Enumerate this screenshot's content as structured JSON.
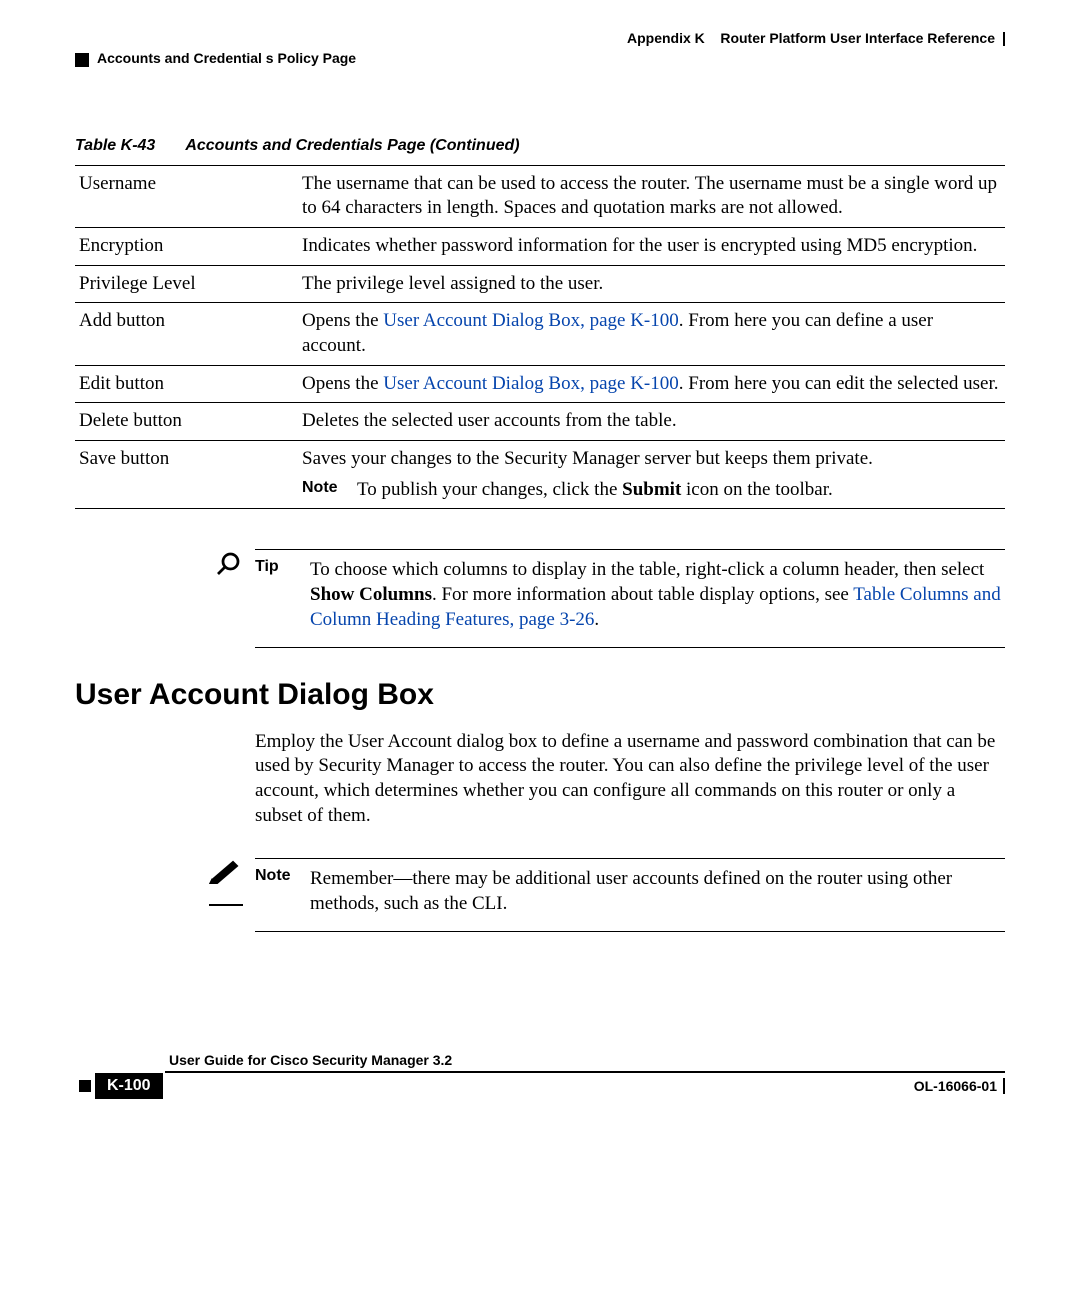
{
  "header": {
    "appendix": "Appendix K",
    "appendix_title": "Router Platform User Interface Reference",
    "section": "Accounts and Credential s Policy Page"
  },
  "table": {
    "number": "Table K-43",
    "title": "Accounts and Credentials Page (Continued)",
    "rows": [
      {
        "name": "Username",
        "desc": "The username that can be used to access the router. The username must be a single word up to 64 characters in length. Spaces and quotation marks are not allowed."
      },
      {
        "name": "Encryption",
        "desc": "Indicates whether password information for the user is encrypted using MD5 encryption."
      },
      {
        "name": "Privilege Level",
        "desc": "The privilege level assigned to the user."
      },
      {
        "name": "Add button",
        "desc_pre": "Opens the ",
        "link": "User Account Dialog Box, page K-100",
        "desc_post": ". From here you can define a user account."
      },
      {
        "name": "Edit button",
        "desc_pre": "Opens the ",
        "link": "User Account Dialog Box, page K-100",
        "desc_post": ". From here you can edit the selected user."
      },
      {
        "name": "Delete button",
        "desc": "Deletes the selected user accounts from the table."
      },
      {
        "name": "Save button",
        "desc": "Saves your changes to the Security Manager server but keeps them private.",
        "note_label": "Note",
        "note_pre": "To publish your changes, click the ",
        "note_bold": "Submit",
        "note_post": " icon on the toolbar."
      }
    ]
  },
  "tip": {
    "label": "Tip",
    "text_pre": "To choose which columns to display in the table, right-click a column header, then select ",
    "bold": "Show Columns",
    "text_mid": ". For more information about table display options, see ",
    "link": "Table Columns and Column Heading Features, page 3-26",
    "text_post": "."
  },
  "section_heading": "User Account Dialog Box",
  "section_body": "Employ the User Account dialog box to define a username and password combination that can be used by Security Manager to access the router. You can also define the privilege level of the user account, which determines whether you can configure all commands on this router or only a subset of them.",
  "note": {
    "label": "Note",
    "text": "Remember—there may be additional user accounts defined on the router using other methods, such as the CLI."
  },
  "footer": {
    "guide": "User Guide for Cisco Security Manager 3.2",
    "page": "K-100",
    "doc": "OL-16066-01"
  }
}
